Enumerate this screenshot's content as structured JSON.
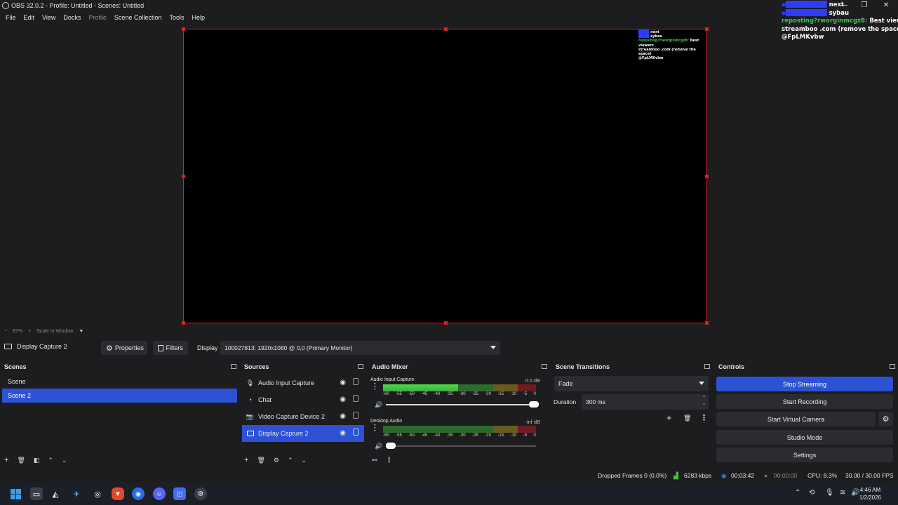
{
  "window": {
    "title": "OBS 32.0.2 - Profile: Untitled - Scenes: Untitled"
  },
  "menu": [
    "File",
    "Edit",
    "View",
    "Docks",
    "Profile",
    "Scene Collection",
    "Tools",
    "Help"
  ],
  "overlay_chat": {
    "user1": "next",
    "user2": "sybau",
    "bot_name": "reposting?rworginmcgz8:",
    "message_line1": "Best viewers",
    "message_line2": "streamboo .com (remove the space)",
    "message_line3": "@FpLMKvbw"
  },
  "preview": {
    "zoom": "87%",
    "zoom_plus": "+",
    "zoom_minus": "−",
    "scale_mode": "Scale to Window"
  },
  "context_bar": {
    "source_name": "Display Capture 2",
    "properties_label": "Properties",
    "filters_label": "Filters",
    "display_label": "Display",
    "display_value": "100027813: 1920x1080 @ 0,0 (Primary Monitor)"
  },
  "scenes": {
    "title": "Scenes",
    "items": [
      "Scene",
      "Scene 2"
    ],
    "active_index": 1
  },
  "sources": {
    "title": "Sources",
    "items": [
      {
        "name": "Audio Input Capture",
        "icon": "microphone-icon"
      },
      {
        "name": "Chat",
        "icon": "browser-icon"
      },
      {
        "name": "Video Capture Device 2",
        "icon": "camera-icon"
      },
      {
        "name": "Display Capture 2",
        "icon": "monitor-icon"
      }
    ],
    "active_index": 3
  },
  "audio_mixer": {
    "title": "Audio Mixer",
    "channels": [
      {
        "name": "Audio Input Capture",
        "db": "0.0 dB",
        "level": 0.49,
        "volume": 1.0
      },
      {
        "name": "Desktop Audio",
        "db": "-inf dB",
        "level": 0,
        "volume": 0.05
      }
    ],
    "scale": [
      "-60",
      "-55",
      "-50",
      "-45",
      "-40",
      "-35",
      "-30",
      "-25",
      "-20",
      "-15",
      "-10",
      "-5",
      "0"
    ]
  },
  "scene_transitions": {
    "title": "Scene Transitions",
    "transition": "Fade",
    "duration_label": "Duration",
    "duration_value": "300 ms"
  },
  "controls": {
    "title": "Controls",
    "stop_streaming": "Stop Streaming",
    "start_recording": "Start Recording",
    "start_virtual_camera": "Start Virtual Camera",
    "studio_mode": "Studio Mode",
    "settings": "Settings"
  },
  "status": {
    "dropped_frames": "Dropped Frames 0 (0.0%)",
    "bitrate": "6283 kbps",
    "stream_time": "00:03:42",
    "record_time": "00:00:00",
    "cpu": "CPU: 8.3%",
    "fps": "30.00 / 30.00 FPS"
  },
  "taskbar": {
    "time": "4:46 AM",
    "date": "1/2/2026"
  },
  "colors": {
    "accent": "#2d52d6",
    "selection_border": "#d2232a",
    "bg": "#1d1d1f",
    "button_bg": "#2b2c30"
  }
}
